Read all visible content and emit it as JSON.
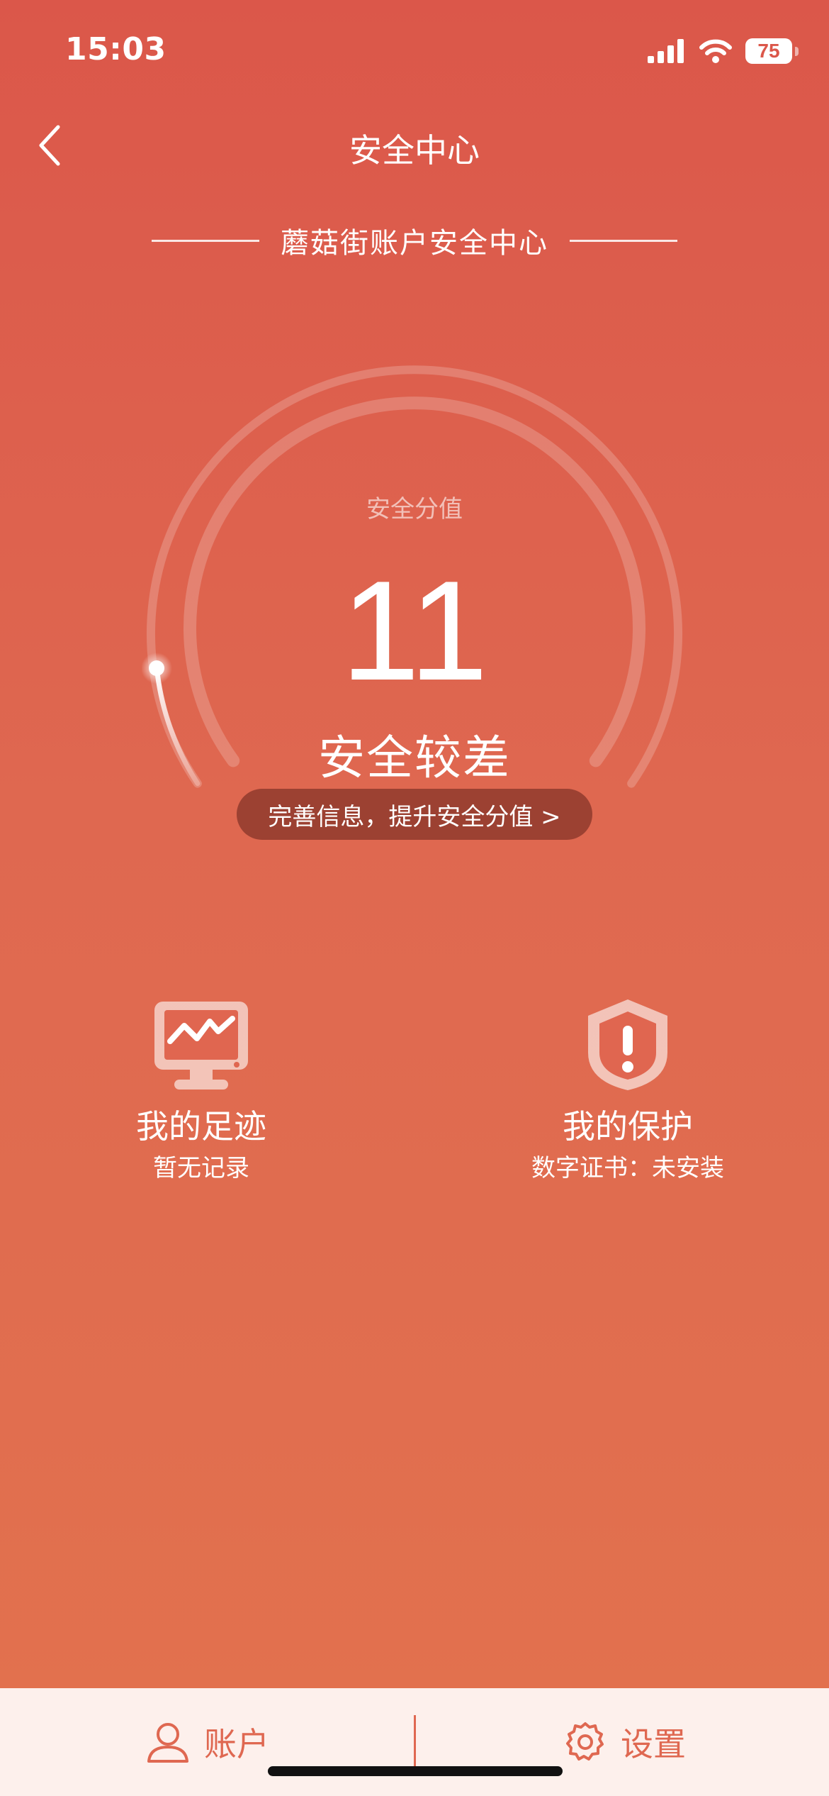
{
  "status_bar": {
    "time": "15:03",
    "battery": "75"
  },
  "nav": {
    "title": "安全中心"
  },
  "subtitle": "蘑菇街账户安全中心",
  "security": {
    "score_label": "安全分值",
    "score": "11",
    "status": "安全较差",
    "improve_button": "完善信息，提升安全分值 >"
  },
  "features": {
    "footprint": {
      "title": "我的足迹",
      "subtitle": "暂无记录"
    },
    "protection": {
      "title": "我的保护",
      "subtitle": "数字证书：未安装"
    }
  },
  "tabbar": {
    "account": "账户",
    "settings": "设置"
  },
  "icons": [
    "chevron-left-icon",
    "signal-icon",
    "wifi-icon",
    "battery-icon",
    "monitor-activity-icon",
    "shield-alert-icon",
    "user-icon",
    "gear-icon"
  ],
  "colors": {
    "background_top": "#db574a",
    "background_bottom": "#e2724e",
    "button": "#9c4132",
    "tabbar": "#fdf0ec",
    "tab_text": "#df6851"
  }
}
